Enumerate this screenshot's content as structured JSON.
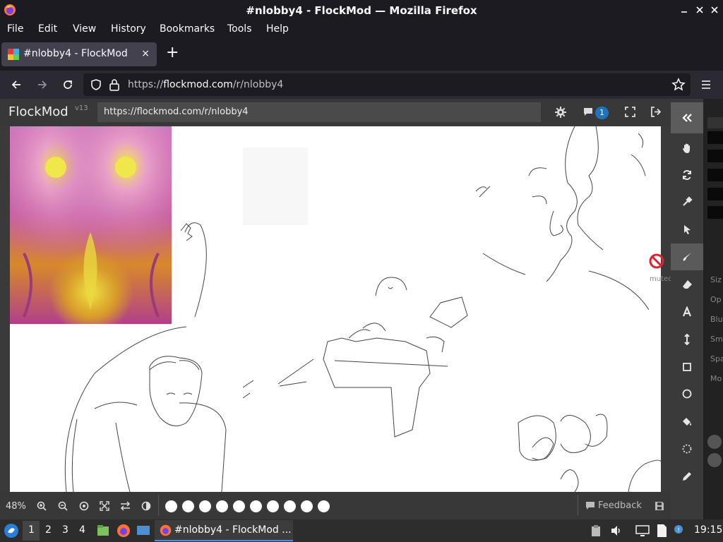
{
  "window": {
    "title": "#nlobby4 - FlockMod — Mozilla Firefox"
  },
  "menu": [
    "File",
    "Edit",
    "View",
    "History",
    "Bookmarks",
    "Tools",
    "Help"
  ],
  "tab": {
    "label": "#nlobby4 - FlockMod",
    "close": "×",
    "new_tab": "+"
  },
  "url": {
    "prefix": "https://",
    "domain": "flockmod.com",
    "path": "/r/nlobby4"
  },
  "flockmod": {
    "brand": "FlockMod",
    "version": "v13",
    "room_link": "https://flockmod.com/r/nlobby4",
    "chat_badge": "1",
    "muted_label": "muted",
    "zoom": "48%",
    "feedback": "Feedback",
    "swatch_count": 10
  },
  "toolbar_tools": [
    "collapse",
    "hand",
    "rotate",
    "eyedropper",
    "select",
    "brush",
    "eraser",
    "text",
    "move",
    "rectangle",
    "ellipse",
    "fill",
    "lasso",
    "pencil"
  ],
  "side_panel": [
    "Siz",
    "Op",
    "Blu",
    "Sm",
    "Spa",
    "Mo"
  ],
  "taskbar": {
    "workspaces": [
      "1",
      "2",
      "3",
      "4"
    ],
    "active_task": "#nlobby4 - FlockMod ...",
    "clock": "19:15"
  },
  "colors": {
    "firefox_dark": "#1c1b22",
    "navbar": "#2b2a33",
    "flockmod_panel": "#383838",
    "canvas": "#ffffff",
    "chat_badge": "#1e73be",
    "muted_red": "#d9262e"
  }
}
